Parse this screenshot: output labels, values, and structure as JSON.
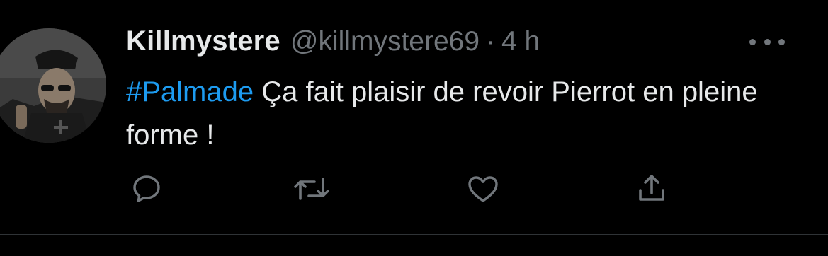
{
  "tweet": {
    "display_name": "Killmystere",
    "handle": "@killmystere69",
    "separator": "·",
    "time": "4 h",
    "hashtag": "#Palmade",
    "text_after_hashtag": " Ça fait plaisir de revoir Pierrot en pleine forme !"
  },
  "actions": {
    "reply_icon": "reply-icon",
    "retweet_icon": "retweet-icon",
    "like_icon": "heart-icon",
    "share_icon": "share-icon",
    "more_icon": "more-icon"
  },
  "colors": {
    "background": "#000000",
    "text": "#e7e9ea",
    "secondary": "#71767b",
    "accent": "#1d9bf0",
    "divider": "#2f3336"
  }
}
